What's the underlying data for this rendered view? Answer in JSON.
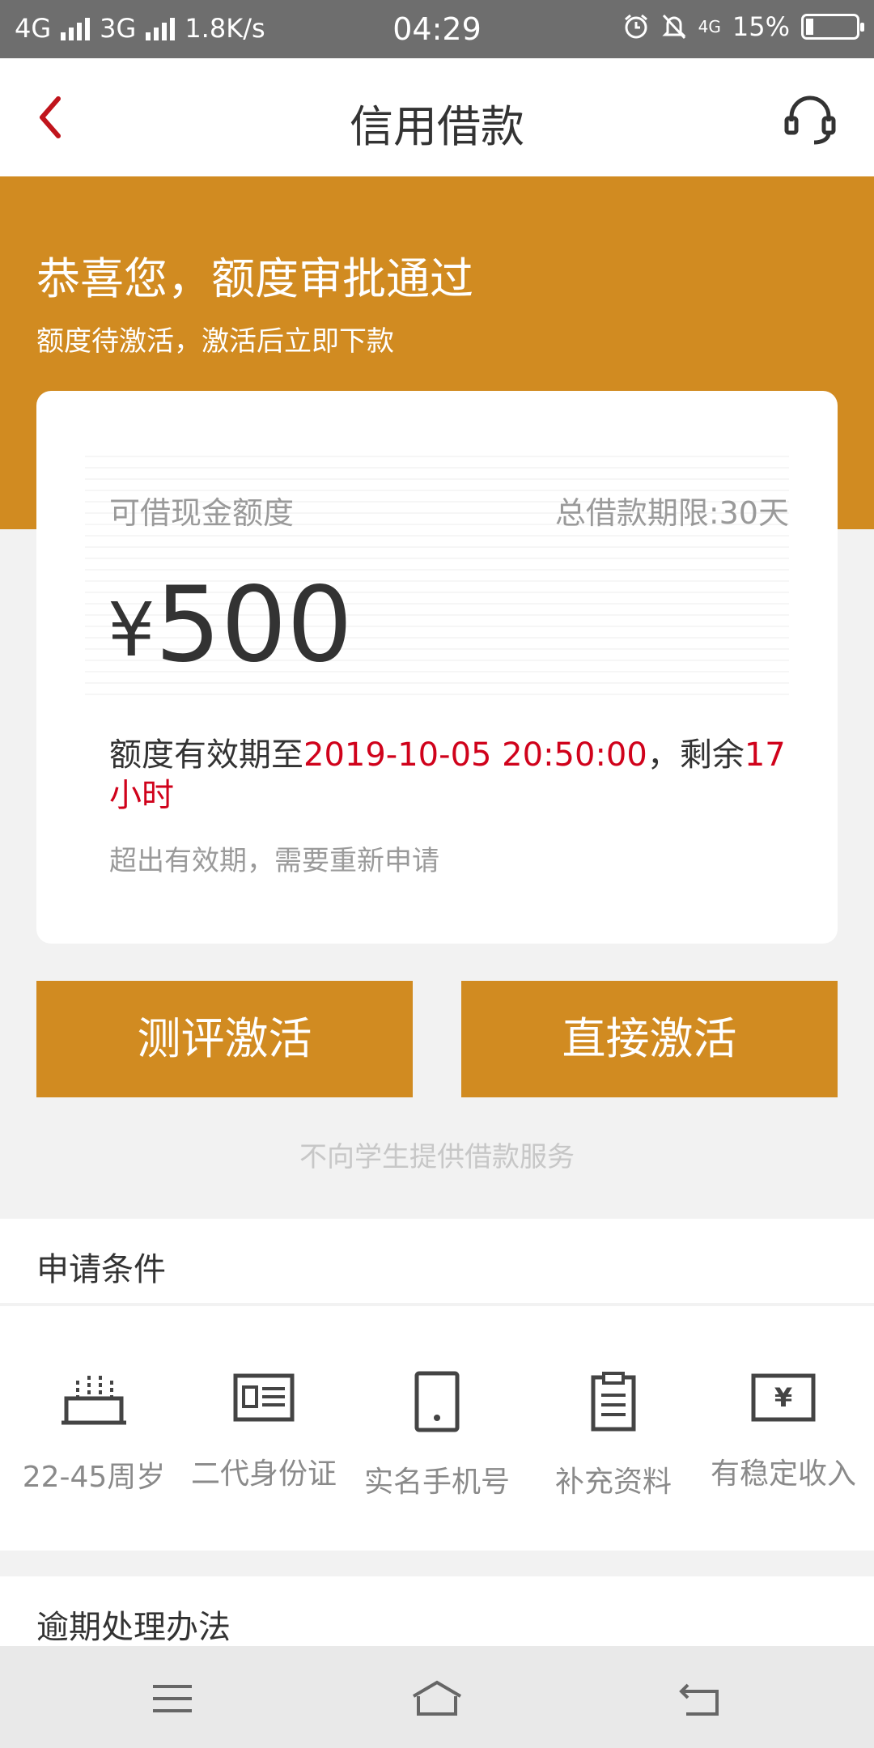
{
  "status_bar": {
    "network_1": "4G",
    "network_2": "3G",
    "speed": "1.8K/s",
    "time": "04:29",
    "network_3": "4G",
    "battery": "15%"
  },
  "header": {
    "title": "信用借款",
    "back_icon": "chevron-left-icon",
    "service_icon": "headset-icon"
  },
  "banner": {
    "title": "恭喜您，额度审批通过",
    "subtitle": "额度待激活，激活后立即下款"
  },
  "card": {
    "quota_label": "可借现金额度",
    "term": "总借款期限:30天",
    "currency": "¥",
    "amount": "500",
    "valid_prefix": "额度有效期至",
    "valid_date": "2019-10-05 20:50:00",
    "valid_mid": "，剩余",
    "remaining": "17小时",
    "expire_note": "超出有效期，需要重新申请"
  },
  "buttons": {
    "evaluate": "测评激活",
    "direct": "直接激活"
  },
  "notice": "不向学生提供借款服务",
  "conditions": {
    "title": "申请条件",
    "items": [
      {
        "label": "22-45周岁",
        "icon": "birthday-cake-icon"
      },
      {
        "label": "二代身份证",
        "icon": "id-card-icon"
      },
      {
        "label": "实名手机号",
        "icon": "phone-icon"
      },
      {
        "label": "补充资料",
        "icon": "clipboard-icon"
      },
      {
        "label": "有稳定收入",
        "icon": "income-yen-icon"
      }
    ]
  },
  "overdue": {
    "title": "逾期处理办法"
  },
  "colors": {
    "accent": "#d18b21",
    "highlight": "#d0021b"
  }
}
